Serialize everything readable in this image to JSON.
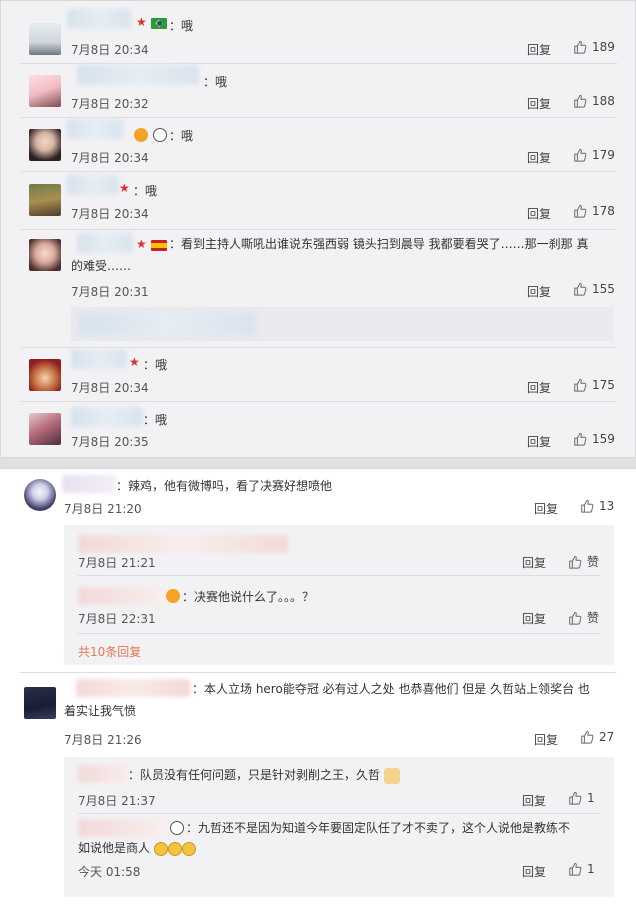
{
  "top_comments": [
    {
      "text": "：哦",
      "time": "7月8日 20:34",
      "reply": "回复",
      "likes": "189"
    },
    {
      "text": "：哦",
      "time": "7月8日 20:32",
      "reply": "回复",
      "likes": "188"
    },
    {
      "text": "：哦",
      "time": "7月8日 20:34",
      "reply": "回复",
      "likes": "179"
    },
    {
      "text": "：哦",
      "time": "7月8日 20:34",
      "reply": "回复",
      "likes": "178"
    },
    {
      "text_line1": "：看到主持人嘶吼出谁说东强西弱 镜头扫到晨导 我都要看哭了……那一刹那 真",
      "text_line2": "的难受……",
      "time": "7月8日 20:31",
      "reply": "回复",
      "likes": "155"
    },
    {
      "text": "：哦",
      "time": "7月8日 20:34",
      "reply": "回复",
      "likes": "175"
    },
    {
      "text": "：哦",
      "time": "7月8日 20:35",
      "reply": "回复",
      "likes": "159"
    }
  ],
  "thread1": {
    "text": "：辣鸡，他有微博吗，看了决赛好想喷他",
    "time": "7月8日 21:20",
    "reply": "回复",
    "likes": "13",
    "subs": [
      {
        "time": "7月8日 21:21",
        "reply": "回复",
        "likes": "赞"
      },
      {
        "text": "：决赛他说什么了。。。？",
        "time": "7月8日 22:31",
        "reply": "回复",
        "likes": "赞"
      }
    ],
    "more": "共10条回复"
  },
  "thread2": {
    "text_line1": "：本人立场 hero能夺冠 必有过人之处 也恭喜他们 但是 久哲站上领奖台 也",
    "text_line2": "着实让我气愤",
    "time": "7月8日 21:26",
    "reply": "回复",
    "likes": "27",
    "subs": [
      {
        "text": "：队员没有任何问题，只是针对剥削之王，久哲",
        "time": "7月8日 21:37",
        "reply": "回复",
        "likes": "1"
      },
      {
        "text_line1": "：九哲还不是因为知道今年要固定队任了才不卖了，这个人说他是教练不",
        "text_line2": "如说他是商人",
        "time": "今天 01:58",
        "reply": "回复",
        "likes": "1"
      }
    ]
  },
  "colors": {
    "accent": "#eb7350",
    "star": "#e0302a",
    "panel": "#f2f2f5"
  }
}
